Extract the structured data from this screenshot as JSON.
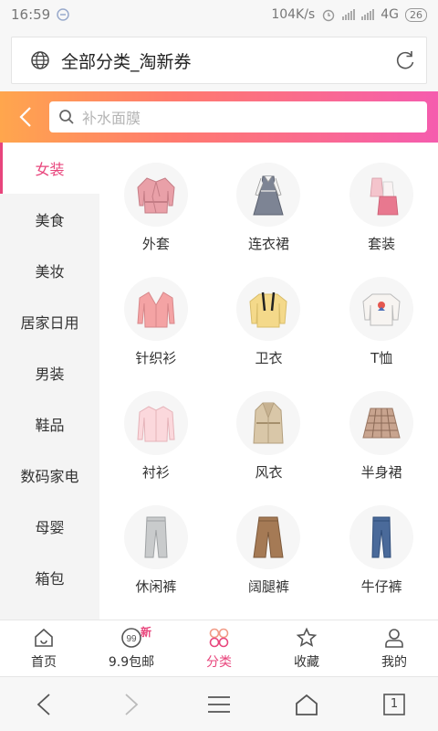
{
  "status": {
    "time": "16:59",
    "speed": "104K/s",
    "network": "4G",
    "battery": "26"
  },
  "urlbar": {
    "title": "全部分类_淘新券"
  },
  "search": {
    "placeholder": "补水面膜"
  },
  "sidebar": {
    "items": [
      {
        "label": "女装"
      },
      {
        "label": "美食"
      },
      {
        "label": "美妆"
      },
      {
        "label": "居家日用"
      },
      {
        "label": "男装"
      },
      {
        "label": "鞋品"
      },
      {
        "label": "数码家电"
      },
      {
        "label": "母婴"
      },
      {
        "label": "箱包"
      }
    ]
  },
  "grid": {
    "items": [
      {
        "label": "外套",
        "icon": "pink-jacket-icon"
      },
      {
        "label": "连衣裙",
        "icon": "dress-icon"
      },
      {
        "label": "套装",
        "icon": "suit-set-icon"
      },
      {
        "label": "针织衫",
        "icon": "knit-sweater-icon"
      },
      {
        "label": "卫衣",
        "icon": "hoodie-icon"
      },
      {
        "label": "T恤",
        "icon": "tshirt-icon"
      },
      {
        "label": "衬衫",
        "icon": "blouse-icon"
      },
      {
        "label": "风衣",
        "icon": "trench-coat-icon"
      },
      {
        "label": "半身裙",
        "icon": "plaid-skirt-icon"
      },
      {
        "label": "休闲裤",
        "icon": "casual-pants-icon"
      },
      {
        "label": "阔腿裤",
        "icon": "wide-pants-icon"
      },
      {
        "label": "牛仔裤",
        "icon": "jeans-icon"
      }
    ]
  },
  "tabbar": {
    "items": [
      {
        "label": "首页"
      },
      {
        "label": "9.9包邮",
        "badge": "新"
      },
      {
        "label": "分类"
      },
      {
        "label": "收藏"
      },
      {
        "label": "我的"
      }
    ]
  },
  "navbar": {
    "tabs_count": "1"
  },
  "colors": {
    "accent": "#e8457c",
    "gradient_start": "#ffa64d",
    "gradient_end": "#f55cae"
  }
}
